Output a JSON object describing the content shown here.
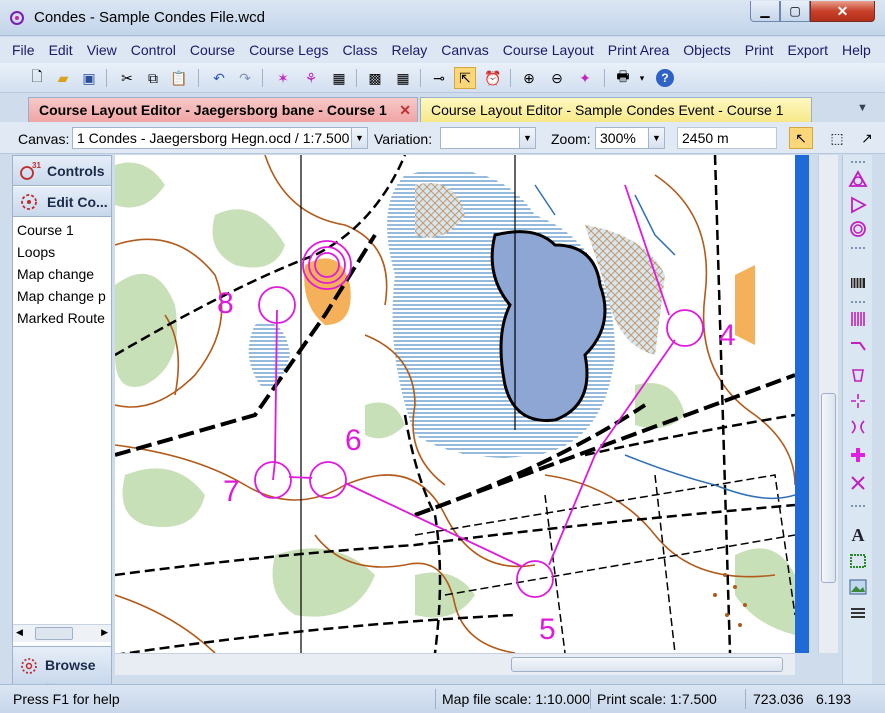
{
  "window": {
    "title": "Condes - Sample Condes File.wcd"
  },
  "menu": [
    "File",
    "Edit",
    "View",
    "Control",
    "Course",
    "Course Legs",
    "Class",
    "Relay",
    "Canvas",
    "Course Layout",
    "Print Area",
    "Objects",
    "Print",
    "Export",
    "Help"
  ],
  "tabs": [
    {
      "label": "Course Layout Editor - Jaegersborg bane - Course 1",
      "color": "#f3b2b2"
    },
    {
      "label": "Course Layout Editor - Sample Condes Event - Course 1",
      "color": "#f8ec9a"
    }
  ],
  "canvas_bar": {
    "canvas_label": "Canvas:",
    "canvas_value": "1 Condes - Jaegersborg Hegn.ocd    / 1:7.500",
    "variation_label": "Variation:",
    "variation_value": "",
    "zoom_label": "Zoom:",
    "zoom_value": "300%",
    "distance_value": "2450 m"
  },
  "left_panel": {
    "controls_label": "Controls",
    "edit_label": "Edit Co...",
    "items": [
      "Course 1",
      "Loops",
      "Map change",
      "Map change p",
      "Marked Route"
    ],
    "selected_index": 0,
    "browse_label": "Browse ..."
  },
  "map": {
    "control_numbers": [
      "8",
      "7",
      "6",
      "5",
      "4"
    ],
    "course_color": "#e01adc"
  },
  "status": {
    "help": "Press F1 for help",
    "map_scale": "Map file scale: 1:10.000",
    "print_scale": "Print scale: 1:7.500",
    "coord_x": "723.036",
    "coord_y": "6.193"
  }
}
